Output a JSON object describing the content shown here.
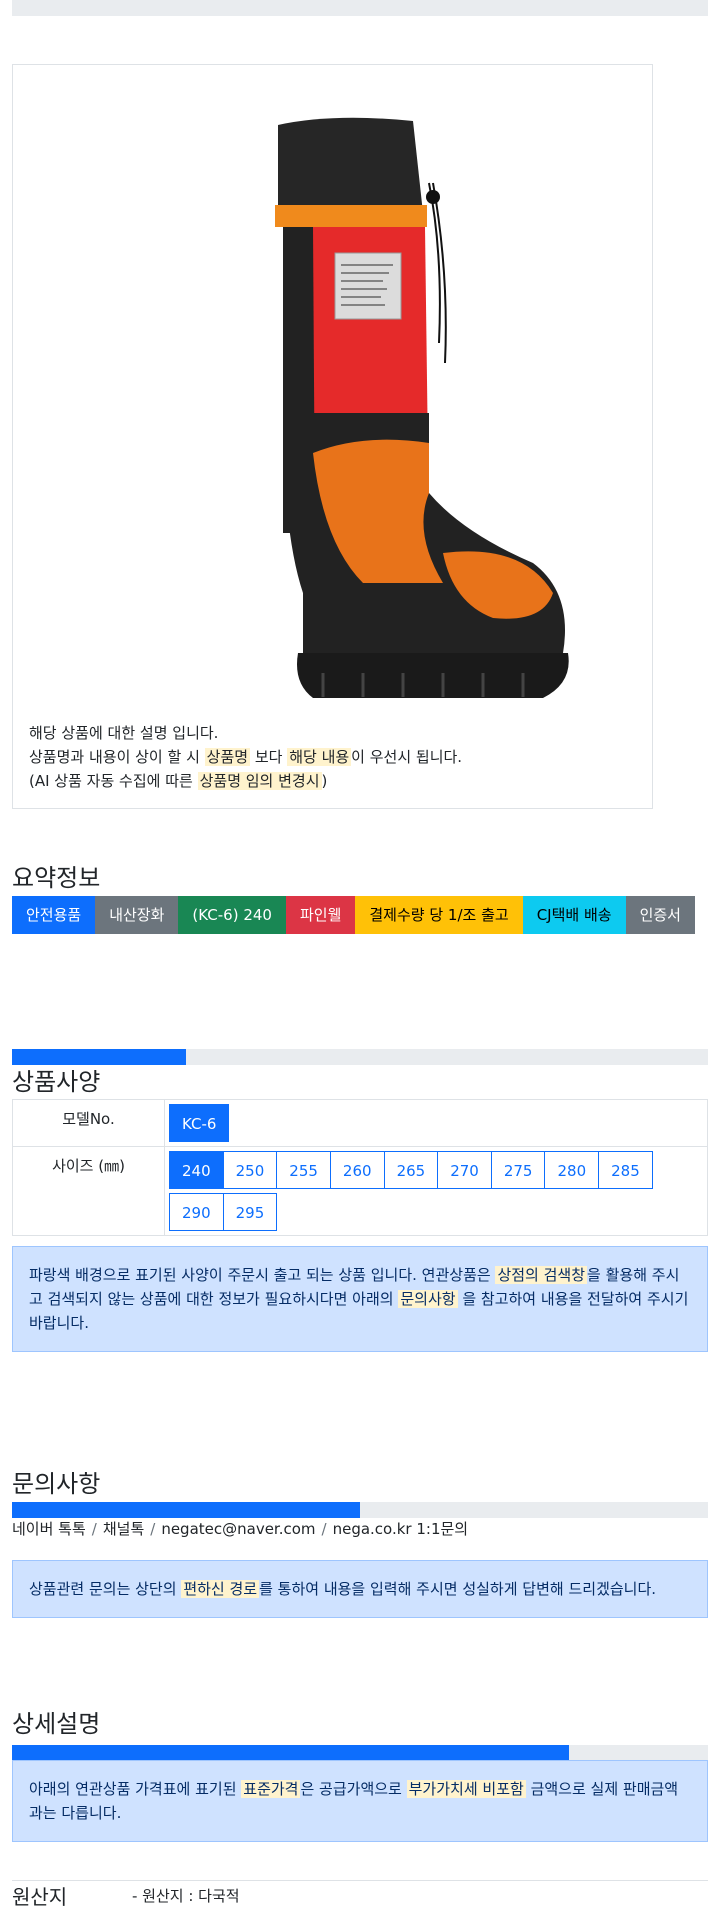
{
  "product": {
    "image_alt": "안전 장화 (파인웰 KC-6)",
    "desc_line1": "해당 상품에 대한 설명 입니다.",
    "desc_line2_a": "상품명과 내용이 상이 할 시 ",
    "desc_line2_hl1": "상품명",
    "desc_line2_b": " 보다 ",
    "desc_line2_hl2": "해당 내용",
    "desc_line2_c": "이 우선시 됩니다.",
    "desc_line3_a": "(AI 상품 자동 수집에 따른 ",
    "desc_line3_hl": "상품명 임의 변경시",
    "desc_line3_b": ")"
  },
  "summary": {
    "title": "요약정보",
    "badges": [
      {
        "label": "안전용품",
        "color": "#0d6efd",
        "text_color": "#ffffff"
      },
      {
        "label": "내산장화",
        "color": "#6c757d",
        "text_color": "#ffffff"
      },
      {
        "label": "(KC-6) 240",
        "color": "#198754",
        "text_color": "#ffffff"
      },
      {
        "label": "파인웰",
        "color": "#dc3545",
        "text_color": "#ffffff"
      },
      {
        "label": "결제수량 당 1/조 출고",
        "color": "#ffc107",
        "text_color": "#000000"
      },
      {
        "label": "CJ택배 배송",
        "color": "#0dcaf0",
        "text_color": "#000000"
      },
      {
        "label": "인증서",
        "color": "#6c757d",
        "text_color": "#ffffff"
      }
    ]
  },
  "specs": {
    "title": "상품사양",
    "progress": 0.25,
    "model_label": "모델No.",
    "model_value": "KC-6",
    "size_label": "사이즈 (㎜)",
    "sizes": [
      "240",
      "250",
      "255",
      "260",
      "265",
      "270",
      "275",
      "280",
      "285",
      "290",
      "295"
    ],
    "selected_size": "240",
    "notice_a": "파랑색 배경으로 표기된 사양이 주문시 출고 되는 상품 입니다. 연관상품은 ",
    "notice_hl1": "상점의 검색창",
    "notice_b": "을 활용해 주시고 검색되지 않는 상품에 대한 정보가 필요하시다면 아래의 ",
    "notice_hl2": "문의사항",
    "notice_c": " 을 참고하여 내용을 전달하여 주시기 바랍니다."
  },
  "inquiry": {
    "title": "문의사항",
    "progress": 0.5,
    "links": [
      "네이버 톡톡",
      "채널톡",
      "negatec@naver.com",
      "nega.co.kr 1:1문의"
    ],
    "notice_a": "상품관련 문의는 상단의 ",
    "notice_hl": "편하신 경로",
    "notice_b": "를 통하여 내용을 입력해 주시면 성실하게 답변해 드리겠습니다."
  },
  "detail": {
    "title": "상세설명",
    "progress": 0.8,
    "notice_a": "아래의 연관상품 가격표에 표기된 ",
    "notice_hl1": "표준가격",
    "notice_b": "은 공급가액으로 ",
    "notice_hl2": "부가가치세 비포함",
    "notice_c": " 금액으로 실제 판매금액과는 다릅니다."
  },
  "origin": {
    "label": "원산지",
    "value": "- 원산지 : 다국적"
  }
}
